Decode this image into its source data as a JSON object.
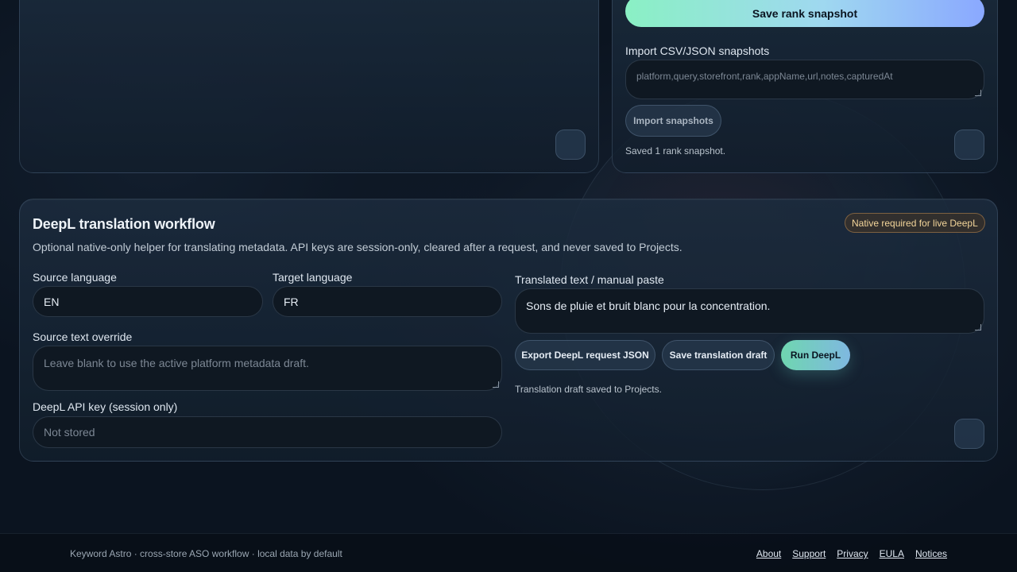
{
  "rank_panel": {
    "save_button": "Save rank snapshot",
    "import_label": "Import CSV/JSON snapshots",
    "import_placeholder": "platform,query,storefront,rank,appName,url,notes,capturedAt",
    "import_button": "Import snapshots",
    "status": "Saved 1 rank snapshot."
  },
  "deepl": {
    "title": "DeepL translation workflow",
    "badge": "Native required for live DeepL",
    "description": "Optional native-only helper for translating metadata. API keys are session-only, cleared after a request, and never saved to Projects.",
    "source_language_label": "Source language",
    "source_language_value": "EN",
    "target_language_label": "Target language",
    "target_language_value": "FR",
    "source_override_label": "Source text override",
    "source_override_placeholder": "Leave blank to use the active platform metadata draft.",
    "api_key_label": "DeepL API key (session only)",
    "api_key_placeholder": "Not stored",
    "translated_label": "Translated text / manual paste",
    "translated_value": "Sons de pluie et bruit blanc pour la concentration.",
    "export_button": "Export DeepL request JSON",
    "save_draft_button": "Save translation draft",
    "run_button": "Run DeepL",
    "status": "Translation draft saved to Projects."
  },
  "footer": {
    "text": "Keyword Astro · cross-store ASO workflow · local data by default",
    "links": [
      "About",
      "Support",
      "Privacy",
      "EULA",
      "Notices"
    ]
  },
  "colors": {
    "accent_start": "#8af0c4",
    "accent_end": "#8aa8ff",
    "badge": "#f3d59a",
    "background": "#0b1420"
  }
}
